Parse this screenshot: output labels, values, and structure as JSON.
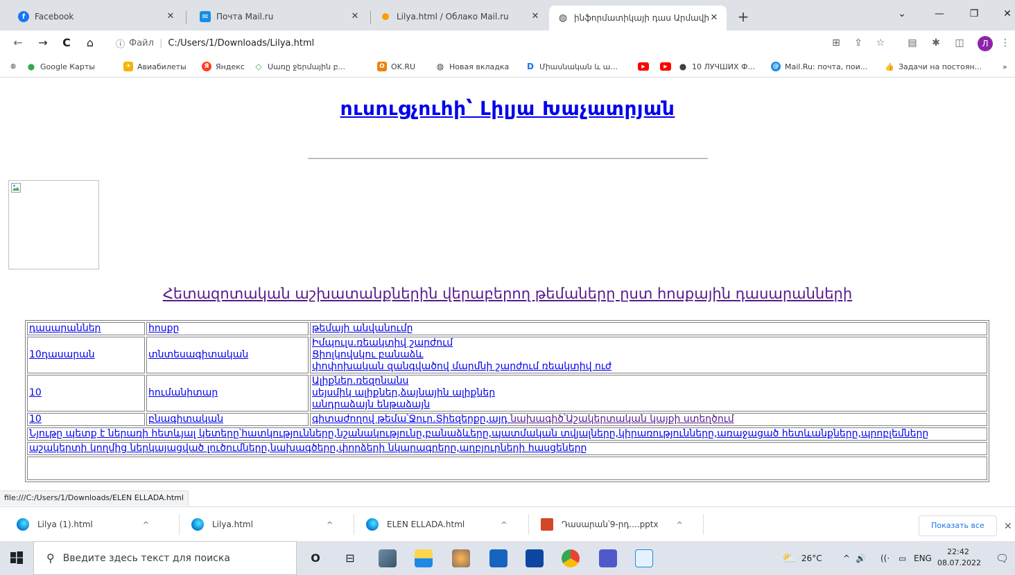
{
  "browser": {
    "tabs": [
      {
        "title": "Facebook",
        "favicon_color": "#1877f2",
        "favicon_glyph": "f",
        "active": false
      },
      {
        "title": "Почта Mail.ru",
        "favicon_color": "#168de2",
        "favicon_glyph": "✉",
        "active": false
      },
      {
        "title": "Lilya.html / Облако Mail.ru",
        "favicon_color": "#ff9e00",
        "favicon_glyph": "",
        "active": false
      },
      {
        "title": "ինֆորմատիկայի դաս Արմավի",
        "favicon_color": "#3c4043",
        "favicon_glyph": "◍",
        "active": true
      }
    ],
    "close_glyph": "✕",
    "new_tab_glyph": "+",
    "window_controls": {
      "dropdown": "⌄",
      "minimize": "—",
      "maximize": "❐",
      "close": "✕"
    },
    "nav": {
      "back": "←",
      "forward": "→",
      "reload": "C",
      "home": "⌂"
    },
    "address": {
      "info_icon": "ⓘ",
      "scheme_label": "Файл",
      "divider": "|",
      "url": "C:/Users/1/Downloads/Lilya.html"
    },
    "profile_initial": "Л",
    "bookmarks": [
      {
        "label": "",
        "icon_color": "#3c4043",
        "glyph": "◍"
      },
      {
        "label": "Google Карты",
        "icon_color": "#34a853",
        "glyph": "●"
      },
      {
        "label": "Авиабилеты",
        "icon_color": "#f4b400",
        "glyph": "✈"
      },
      {
        "label": "Яндекс",
        "icon_color": "#fc3f1d",
        "glyph": "Я"
      },
      {
        "label": "Սառը ջերմային բ...",
        "icon_color": "#34a853",
        "glyph": "◇"
      },
      {
        "label": "OK.RU",
        "icon_color": "#ee8208",
        "glyph": "О"
      },
      {
        "label": "Новая вкладка",
        "icon_color": "#3c4043",
        "glyph": "◍"
      },
      {
        "label": "Միասնական և ա...",
        "icon_color": "#1a73e8",
        "glyph": "D"
      },
      {
        "label": "",
        "icon_color": "#ff0000",
        "glyph": "▶"
      },
      {
        "label": "",
        "icon_color": "#ff0000",
        "glyph": "▶"
      },
      {
        "label": "10 ЛУЧШИХ Ф...",
        "icon_color": "#3c4043",
        "glyph": "●"
      },
      {
        "label": "Mail.Ru: почта, пои...",
        "icon_color": "#168de2",
        "glyph": "@"
      },
      {
        "label": "Задачи на постоян...",
        "icon_color": "#e53935",
        "glyph": "👍"
      }
    ],
    "bookmarks_more": "»"
  },
  "page": {
    "heading": "ուսուցչուհի՝ Լիլյա Խաչատրյան",
    "section_heading": "Հետազոտական աշխատանքներին վերաբերող թեմաները ըստ հոսքային դասարանների",
    "table": {
      "headers": [
        "դասարաններ",
        "հոսքը",
        "թեմայի անվանումը"
      ],
      "rows": [
        {
          "grade": "10դասարան",
          "stream": "տնտեսագիտական",
          "topics": [
            "Իմպուլս.ռեակտիվ շարժում",
            "Ցիոլկովսկու բանաձև",
            "փոփոխական զանգվածով մարմնի շարժում ռեակտիվ ուժ"
          ]
        },
        {
          "grade": "10",
          "stream": "հումանիտար",
          "topics": [
            "Ալիքներ.ռեզոնանս",
            "սեյսմիկ ալիքներ,ձայնային ալիքներ",
            "անդրաձայն ենթաձայն"
          ]
        },
        {
          "grade": "10",
          "stream": "բնագիտական",
          "topic_prefix": "գիտաժողով թեմա՝Ջուր.Տիեզերքը,այդ ",
          "topic_link": "նախագիծ՝Աշակերտական կայքի ստեղծում"
        }
      ],
      "note_row_1": "Նյութը պետք է ներառի հետևյալ կետերը՝հատկությունները,նշանակությունը,բանաձևերը,պատմական տվյալները,կիրառությունները,առաջացած հետևանքները,պրոբլեմները",
      "note_row_2": "աշակերտի կողմից ներկայացված լուծումները,նախագծերը,փորձերի նկարագրերը,աղբյուրների հասցեները"
    },
    "status_url": "file:///C:/Users/1/Downloads/ELEN ELLADA.html"
  },
  "downloads": {
    "items": [
      {
        "name": "Lilya (1).html",
        "icon_color": "#0078d4"
      },
      {
        "name": "Lilya.html",
        "icon_color": "#0078d4"
      },
      {
        "name": "ELEN ELLADA.html",
        "icon_color": "#0078d4"
      },
      {
        "name": "Դասարան՝9-րդ....pptx",
        "icon_color": "#d24726"
      }
    ],
    "chevron": "^",
    "show_all": "Показать все",
    "close": "✕"
  },
  "taskbar": {
    "search_placeholder": "Введите здесь текст для поиска",
    "search_icon": "⚲",
    "cortana": "O",
    "taskview": "⊟",
    "weather": "26°C",
    "tray_arrow": "^",
    "volume": "🔊",
    "wifi": "((·",
    "battery": "▭",
    "lang": "ENG",
    "time": "22:42",
    "date": "08.07.2022",
    "notifications": "🗨"
  }
}
